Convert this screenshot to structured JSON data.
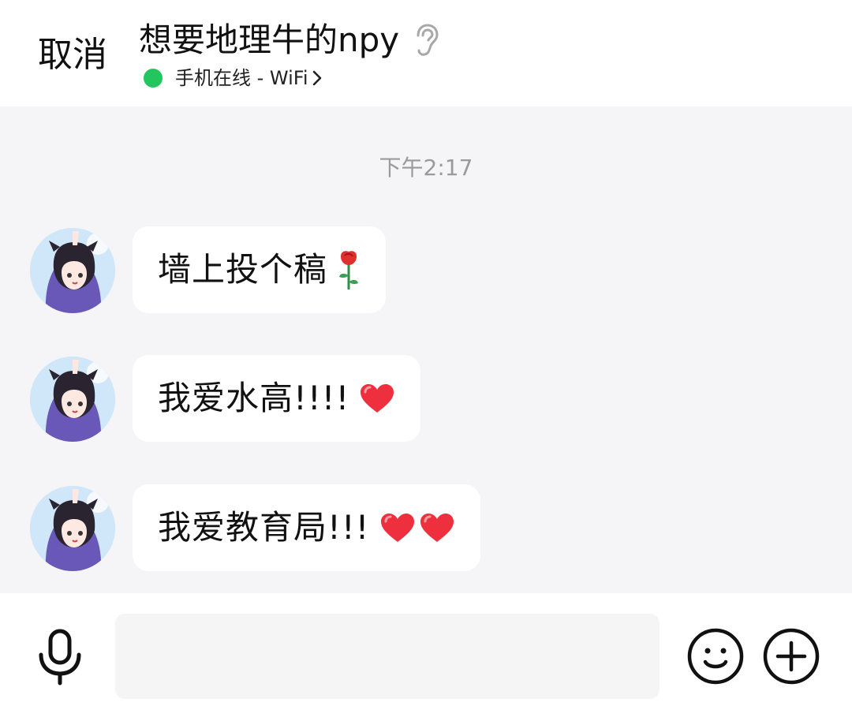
{
  "header": {
    "cancel_label": "取消",
    "title": "想要地理牛的npy",
    "status_text": "手机在线 - WiFi",
    "status_color": "#22c55e",
    "icons": {
      "listen_mode": "ear-icon",
      "status_chevron": "chevron-right-icon"
    }
  },
  "chat": {
    "timestamp": "下午2:17",
    "messages": [
      {
        "text": "墙上投个稿",
        "emoji": [
          "rose"
        ]
      },
      {
        "text": "我爱水高!!!!",
        "emoji": [
          "red-heart"
        ]
      },
      {
        "text": "我爱教育局!!!",
        "emoji": [
          "red-heart",
          "red-heart"
        ]
      }
    ]
  },
  "composer": {
    "input_value": "",
    "input_placeholder": "",
    "icons": {
      "voice": "microphone-icon",
      "emoji": "smiley-icon",
      "more": "plus-icon"
    }
  }
}
